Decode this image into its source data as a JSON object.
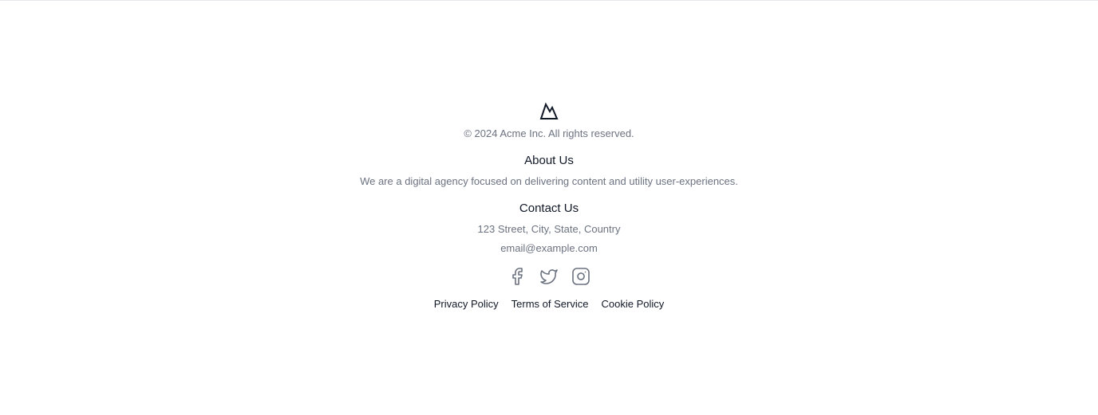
{
  "footer": {
    "logo_icon": "mountain-icon",
    "copyright": "© 2024 Acme Inc. All rights reserved.",
    "about": {
      "title": "About Us",
      "text": "We are a digital agency focused on delivering content and utility user-experiences."
    },
    "contact": {
      "title": "Contact Us",
      "address": "123 Street, City, State, Country",
      "email": "email@example.com"
    },
    "socials": [
      {
        "icon": "facebook-icon"
      },
      {
        "icon": "twitter-icon"
      },
      {
        "icon": "instagram-icon"
      }
    ],
    "legal": [
      {
        "label": "Privacy Policy"
      },
      {
        "label": "Terms of Service"
      },
      {
        "label": "Cookie Policy"
      }
    ]
  },
  "colors": {
    "muted_text": "#6b7280",
    "heading_text": "#111827",
    "icon_stroke": "#6b7280",
    "divider": "#e5e7eb"
  }
}
